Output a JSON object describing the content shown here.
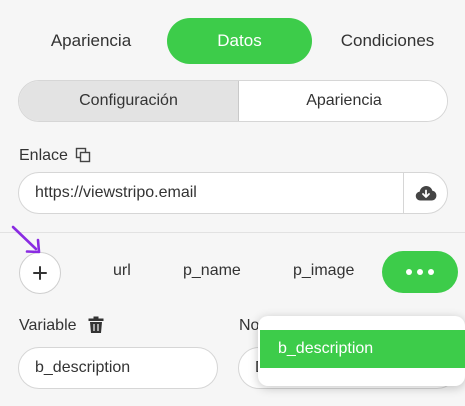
{
  "top_tabs": {
    "appearance": "Apariencia",
    "data": "Datos",
    "conditions": "Condiciones"
  },
  "segmented": {
    "configuration": "Configuración",
    "appearance": "Apariencia"
  },
  "link": {
    "label": "Enlace",
    "value": "https://viewstripo.email"
  },
  "fields": {
    "url": "url",
    "p_name": "p_name",
    "p_image": "p_image"
  },
  "variable": {
    "label": "Variable",
    "value": "b_description"
  },
  "name_field": {
    "label_visible": "No",
    "value_visible": "D"
  },
  "dropdown": {
    "selected": "b_description"
  },
  "colors": {
    "accent": "#3dcc4a",
    "arrow": "#8a2be2"
  },
  "icons": [
    "copy-icon",
    "cloud-download-icon",
    "plus-icon",
    "more-dots-icon",
    "trash-icon",
    "arrow-icon"
  ]
}
